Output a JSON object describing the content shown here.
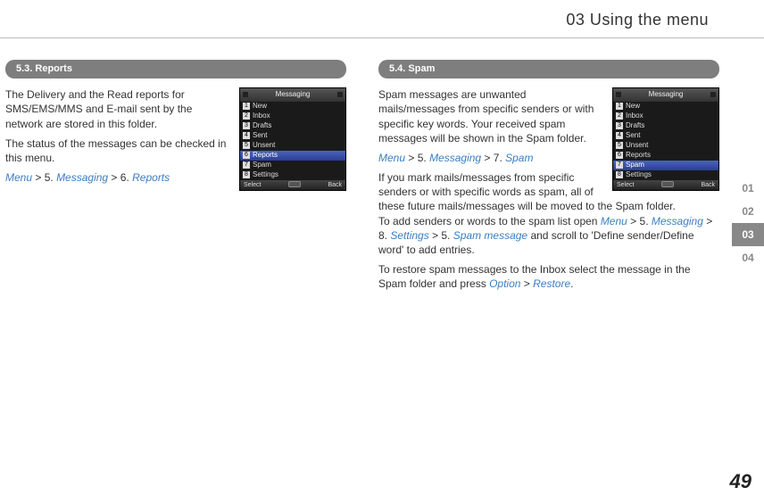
{
  "header": {
    "title": "03 Using the menu"
  },
  "side_tabs": [
    "01",
    "02",
    "03",
    "04"
  ],
  "active_tab_index": 2,
  "page_number": "49",
  "phone_menu": {
    "title": "Messaging",
    "items": [
      "New",
      "Inbox",
      "Drafts",
      "Sent",
      "Unsent",
      "Reports",
      "Spam",
      "Settings"
    ],
    "softkeys": {
      "left": "Select",
      "right": "Back"
    }
  },
  "left": {
    "bar": "5.3. Reports",
    "highlight_index": 5,
    "p1": "The Delivery and the Read reports for SMS/EMS/MMS and E-mail sent by the network are stored in this folder.",
    "p2": "The status of the messages can be checked in this menu.",
    "nav": {
      "a": "Menu",
      "an": " > 5. ",
      "b": "Messaging",
      "bn": " > 6. ",
      "c": "Reports"
    }
  },
  "right": {
    "bar": "5.4. Spam",
    "highlight_index": 6,
    "p1": "Spam messages are unwanted mails/messages from specific senders or with specific key words. Your received spam messages will be shown in the Spam folder.",
    "nav1": {
      "a": "Menu",
      "an": " > 5. ",
      "b": "Messaging",
      "bn": " > 7. ",
      "c": "Spam"
    },
    "p2a": "If you mark mails/messages from specific senders or with specific words as spam, all of these future mails/messages will be moved to the Spam folder.",
    "p2b_pre": "To add senders or words to the spam list open ",
    "nav2": {
      "a": "Menu",
      "an": " > 5. ",
      "b": "Messaging",
      "bn": " > 8. ",
      "c": "Settings",
      "cn": " > 5. ",
      "d": "Spam message"
    },
    "p2b_post": " and scroll to 'Define sender/Define word' to add entries.",
    "p3_pre": "To restore spam messages to the Inbox select the message in the Spam folder and press ",
    "nav3": {
      "a": "Option",
      "an": " > ",
      "b": "Restore"
    },
    "p3_post": "."
  }
}
